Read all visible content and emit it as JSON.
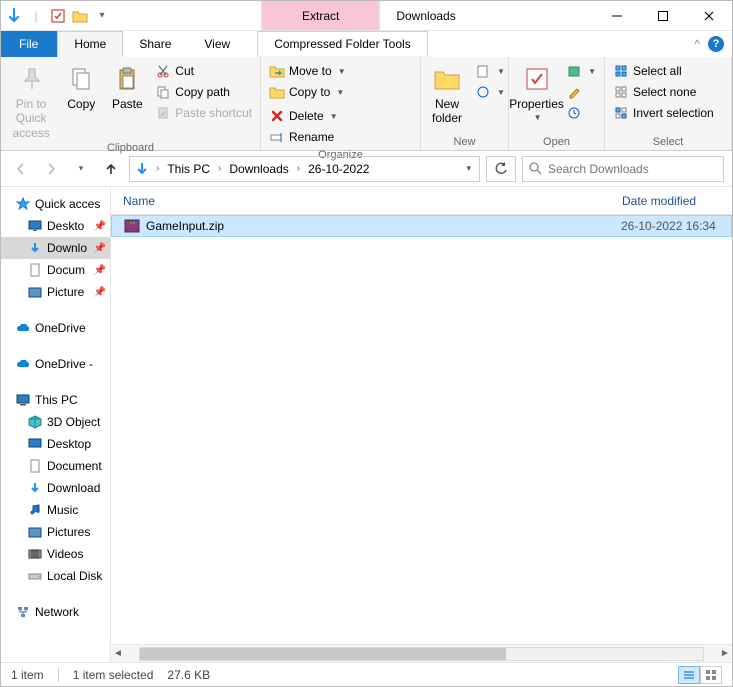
{
  "titlebar": {
    "context_tab": "Extract",
    "title": "Downloads"
  },
  "tabs": {
    "file": "File",
    "home": "Home",
    "share": "Share",
    "view": "View",
    "context": "Compressed Folder Tools"
  },
  "ribbon": {
    "clipboard": {
      "pin": "Pin to Quick access",
      "copy": "Copy",
      "paste": "Paste",
      "cut": "Cut",
      "copy_path": "Copy path",
      "paste_shortcut": "Paste shortcut",
      "label": "Clipboard"
    },
    "organize": {
      "move_to": "Move to",
      "copy_to": "Copy to",
      "delete": "Delete",
      "rename": "Rename",
      "label": "Organize"
    },
    "new": {
      "new_folder": "New folder",
      "label": "New"
    },
    "open": {
      "properties": "Properties",
      "label": "Open"
    },
    "select": {
      "select_all": "Select all",
      "select_none": "Select none",
      "invert": "Invert selection",
      "label": "Select"
    }
  },
  "breadcrumbs": [
    "This PC",
    "Downloads",
    "26-10-2022"
  ],
  "search_placeholder": "Search Downloads",
  "nav": {
    "quick_access": "Quick acces",
    "qa_items": [
      "Deskto",
      "Downlo",
      "Docum",
      "Picture"
    ],
    "onedrive1": "OneDrive",
    "onedrive2": "OneDrive -",
    "this_pc": "This PC",
    "pc_items": [
      "3D Object",
      "Desktop",
      "Document",
      "Download",
      "Music",
      "Pictures",
      "Videos",
      "Local Disk"
    ],
    "network": "Network"
  },
  "columns": {
    "name": "Name",
    "date": "Date modified"
  },
  "files": [
    {
      "name": "GameInput.zip",
      "date": "26-10-2022 16:34"
    }
  ],
  "status": {
    "count": "1 item",
    "selected": "1 item selected",
    "size": "27.6 KB"
  }
}
